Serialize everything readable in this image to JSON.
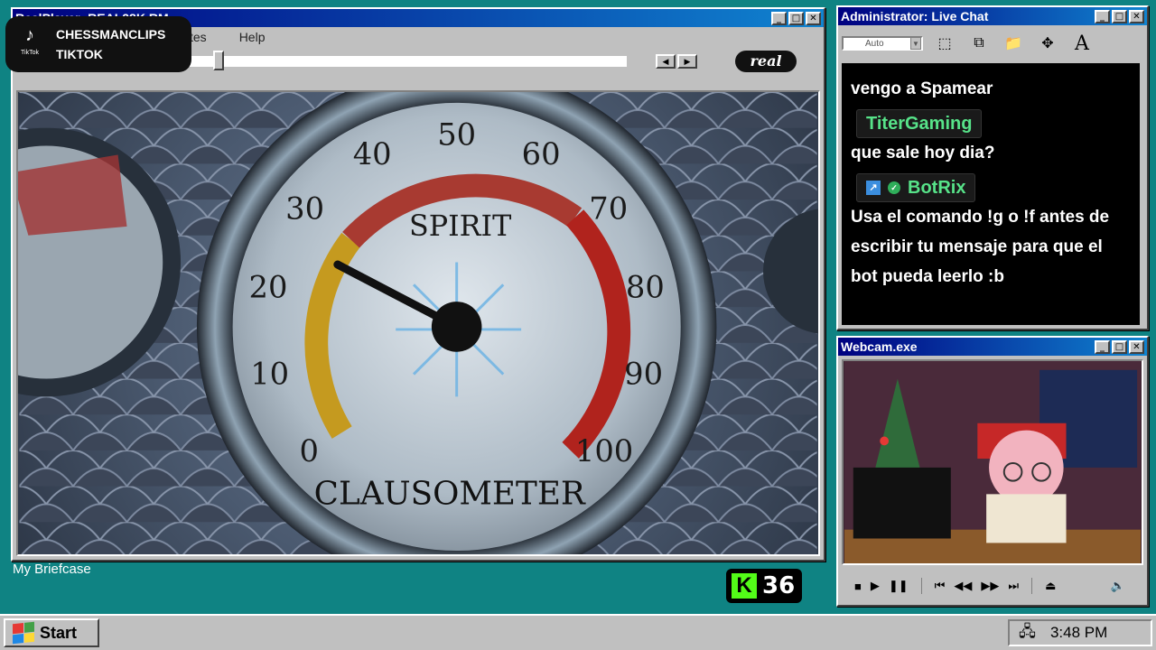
{
  "realplayer": {
    "title": "RealPlayer: REAL28K.RM",
    "menu": [
      "tes",
      "Help"
    ],
    "logo": "real",
    "video": {
      "gauge_title": "SPIRIT",
      "gauge_name": "CLAUSOMETER",
      "ticks": [
        "0",
        "10",
        "20",
        "30",
        "40",
        "50",
        "60",
        "70",
        "80",
        "90",
        "100"
      ],
      "needle_value": 26
    }
  },
  "tiktok": {
    "icon": "tiktok-icon",
    "platform_small": "TikTok",
    "name": "CHESSMANCLIPS",
    "platform": "TIKTOK"
  },
  "chat": {
    "title": "Administrator: Live Chat",
    "font_select": "Auto",
    "messages": [
      {
        "user": "",
        "text": "vengo a Spamear"
      },
      {
        "user": "TiterGaming",
        "text": "que sale hoy dia?"
      },
      {
        "user": "BotRix",
        "text": "Usa el comando !g o !f antes de escribir tu mensaje para que el bot pueda leerlo :b"
      }
    ],
    "username_color": "#57e389"
  },
  "webcam": {
    "title": "Webcam.exe"
  },
  "desktop": {
    "briefcase": "My Briefcase",
    "kick_count": "36",
    "kick_icon": "K",
    "kick_color": "#53fc18"
  },
  "taskbar": {
    "start": "Start",
    "time": "3:48 PM"
  }
}
